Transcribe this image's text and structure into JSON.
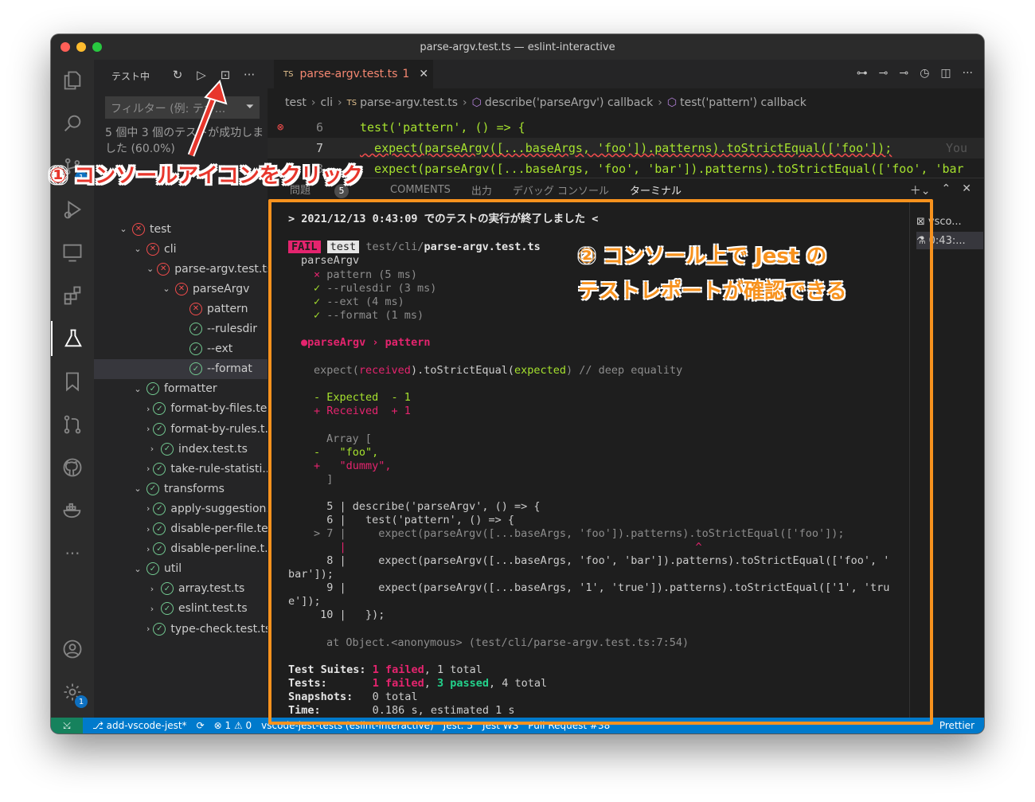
{
  "window": {
    "title": "parse-argv.test.ts — eslint-interactive"
  },
  "sidebar": {
    "header": "テスト中",
    "filter_placeholder": "フィルター (例: テキ...",
    "summary": "5 個中 3 個のテストが成功しました (60.0%)",
    "tree": [
      {
        "label": "test",
        "status": "fail",
        "depth": 0,
        "expanded": true
      },
      {
        "label": "cli",
        "status": "fail",
        "depth": 1,
        "expanded": true
      },
      {
        "label": "parse-argv.test.ts",
        "status": "fail",
        "depth": 2,
        "expanded": true
      },
      {
        "label": "parseArgv",
        "status": "fail",
        "depth": 3,
        "expanded": true
      },
      {
        "label": "pattern",
        "status": "fail",
        "depth": 4
      },
      {
        "label": "--rulesdir",
        "status": "pass",
        "depth": 4
      },
      {
        "label": "--ext",
        "status": "pass",
        "depth": 4
      },
      {
        "label": "--format",
        "status": "pass",
        "depth": 4,
        "selected": true
      },
      {
        "label": "formatter",
        "status": "pass",
        "depth": 1,
        "expanded": true
      },
      {
        "label": "format-by-files.te...",
        "status": "pass",
        "depth": 2,
        "expanded": false
      },
      {
        "label": "format-by-rules.t...",
        "status": "pass",
        "depth": 2,
        "expanded": false
      },
      {
        "label": "index.test.ts",
        "status": "pass",
        "depth": 2,
        "expanded": false
      },
      {
        "label": "take-rule-statisti...",
        "status": "pass",
        "depth": 2,
        "expanded": false
      },
      {
        "label": "transforms",
        "status": "pass",
        "depth": 1,
        "expanded": true
      },
      {
        "label": "apply-suggestion...",
        "status": "pass",
        "depth": 2,
        "expanded": false
      },
      {
        "label": "disable-per-file.te...",
        "status": "pass",
        "depth": 2,
        "expanded": false
      },
      {
        "label": "disable-per-line.t...",
        "status": "pass",
        "depth": 2,
        "expanded": false
      },
      {
        "label": "util",
        "status": "pass",
        "depth": 1,
        "expanded": true
      },
      {
        "label": "array.test.ts",
        "status": "pass",
        "depth": 2,
        "expanded": false
      },
      {
        "label": "eslint.test.ts",
        "status": "pass",
        "depth": 2,
        "expanded": false
      },
      {
        "label": "type-check.test.ts",
        "status": "pass",
        "depth": 2,
        "expanded": false
      }
    ]
  },
  "editor": {
    "tab_label": "parse-argv.test.ts",
    "tab_ts": "TS",
    "tab_errors": "1",
    "breadcrumb": [
      "test",
      "cli",
      "parse-argv.test.ts",
      "describe('parseArgv') callback",
      "test('pattern') callback"
    ],
    "lines": [
      {
        "num": "6",
        "text": "test('pattern', () => {"
      },
      {
        "num": "7",
        "text": "  expect(parseArgv([...baseArgs, 'foo']).patterns).toStrictEqual(['foo']);"
      },
      {
        "num": "8",
        "text": "  expect(parseArgv([...baseArgs, 'foo', 'bar']).patterns).toStrictEqual(['foo', 'bar"
      }
    ],
    "ghost_text": "You"
  },
  "panel": {
    "tabs": [
      "問題",
      "COMMENTS",
      "出力",
      "デバッグ コンソール",
      "ターミナル"
    ],
    "problems_count": "5",
    "active_tab": "ターミナル"
  },
  "terminal": {
    "header": "> 2021/12/13 0:43:09 でのテストの実行が終了しました <",
    "fail_label": "FAIL",
    "test_label": "test",
    "file_dir": "test/cli/",
    "file_name": "parse-argv.test.ts",
    "suite": "parseArgv",
    "results": [
      {
        "mark": "×",
        "text": "pattern (5 ms)",
        "status": "fail"
      },
      {
        "mark": "✓",
        "text": "--rulesdir (3 ms)",
        "status": "pass"
      },
      {
        "mark": "✓",
        "text": "--ext (4 ms)",
        "status": "pass"
      },
      {
        "mark": "✓",
        "text": "--format (1 ms)",
        "status": "pass"
      }
    ],
    "failure_title": "●parseArgv › pattern",
    "expect_line": "expect(received).toStrictEqual(expected) // deep equality",
    "expected_line": "- Expected  - 1",
    "received_line": "+ Received  + 1",
    "array_lines": [
      "Array [",
      "-   \"foo\",",
      "+   \"dummy\",",
      "  ]"
    ],
    "code_lines": [
      "  5 | describe('parseArgv', () => {",
      "  6 |   test('pattern', () => {",
      "> 7 |     expect(parseArgv([...baseArgs, 'foo']).patterns).toStrictEqual(['foo']);",
      "    |                                                      ^",
      "  8 |     expect(parseArgv([...baseArgs, 'foo', 'bar']).patterns).toStrictEqual(['foo', '",
      "bar']);",
      "  9 |     expect(parseArgv([...baseArgs, '1', 'true']).patterns).toStrictEqual(['1', 'tru",
      "e']);",
      " 10 |   });"
    ],
    "at_line": "at Object.<anonymous> (test/cli/parse-argv.test.ts:7:54)",
    "summary": {
      "suites_label": "Test Suites:",
      "suites_failed": "1 failed",
      "suites_total": ", 1 total",
      "tests_label": "Tests:",
      "tests_failed": "1 failed",
      "tests_passed": "3 passed",
      "tests_total": ", 4 total",
      "snapshots_label": "Snapshots:",
      "snapshots_value": "0 total",
      "time_label": "Time:",
      "time_value": "0.186 s, estimated 1 s"
    },
    "side_items": [
      "vsco...",
      "0:43:..."
    ]
  },
  "statusbar": {
    "branch": "add-vscode-jest*",
    "errors": "1",
    "warnings": "0",
    "items": [
      "vscode-jest-tests (eslint-interactive)",
      "Jest: 5",
      "Jest WS",
      "Pull Request #38",
      "Prettier"
    ]
  },
  "annotations": {
    "step1": "① コンソールアイコンをクリック",
    "step2_line1": "② コンソール上で Jest の",
    "step2_line2": "テストレポートが確認できる"
  },
  "colors": {
    "accent": "#007acc",
    "annotation_orange": "#f7921e",
    "annotation_red": "#e8362c",
    "fail": "#f14c4c",
    "pass": "#73c991"
  }
}
